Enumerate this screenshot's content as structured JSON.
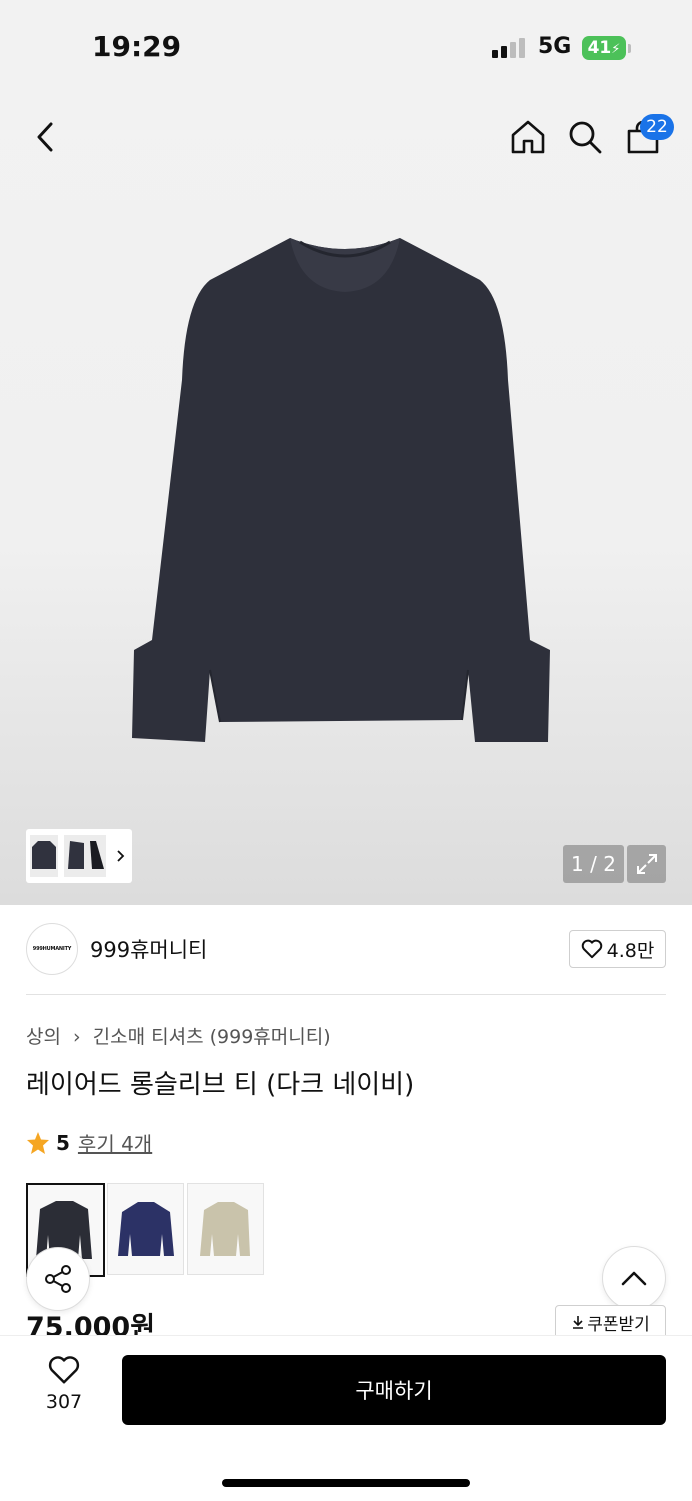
{
  "status_bar": {
    "time": "19:29",
    "network": "5G",
    "battery": "41"
  },
  "header": {
    "cart_count": "22"
  },
  "gallery": {
    "counter": "1 / 2"
  },
  "brand": {
    "logo_text": "999HUMANITY",
    "name": "999휴머니티",
    "likes": "4.8만"
  },
  "product": {
    "breadcrumb": {
      "category": "상의",
      "subcategory": "긴소매 티셔츠 (999휴머니티)"
    },
    "title": "레이어드 롱슬리브 티 (다크 네이비)",
    "rating": "5",
    "reviews": "후기 4개",
    "price": "75,000원",
    "colors": {
      "selected": "#2b2d36",
      "options": [
        "#2b2d36",
        "#2c3266",
        "#c9c3ab"
      ]
    }
  },
  "actions": {
    "coupon": "쿠폰받기",
    "wish_count": "307",
    "buy": "구매하기"
  },
  "icons": [
    "back-icon",
    "home-icon",
    "search-icon",
    "cart-icon",
    "chevron-right-icon",
    "expand-icon",
    "heart-icon",
    "star-icon",
    "share-icon",
    "chevron-up-icon",
    "download-icon"
  ]
}
